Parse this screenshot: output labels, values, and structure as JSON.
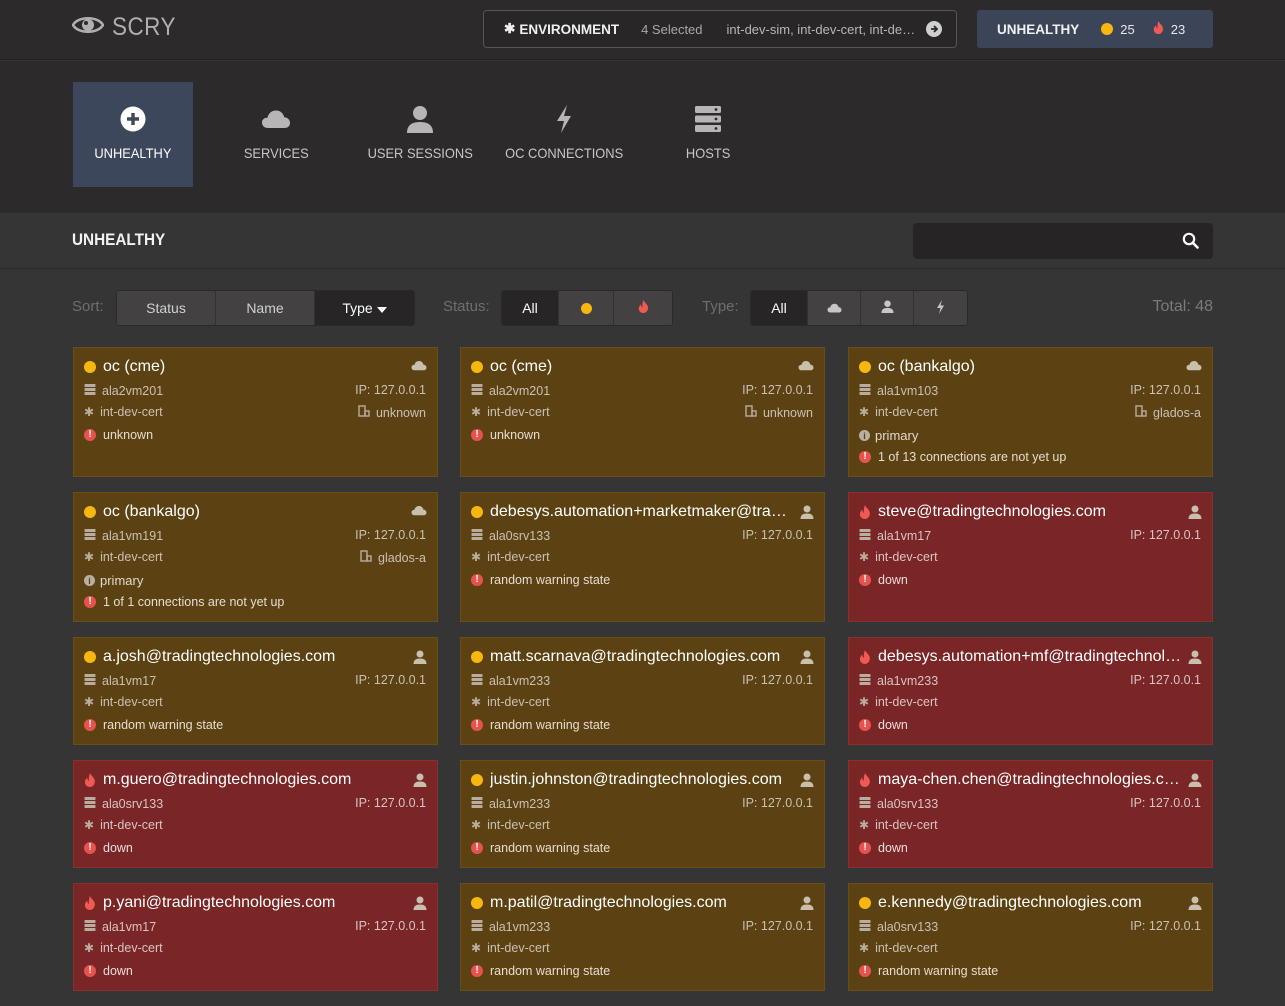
{
  "app": {
    "name": "SCRY"
  },
  "header": {
    "environment_label": "ENVIRONMENT",
    "environment_count": "4 Selected",
    "environment_list": "int-dev-sim, int-dev-cert, int-dev-prod, int-dev-test",
    "unhealthy_label": "UNHEALTHY",
    "warn_count": "25",
    "crit_count": "23"
  },
  "nav": {
    "items": [
      {
        "label": "UNHEALTHY",
        "icon": "plus-circle-icon"
      },
      {
        "label": "SERVICES",
        "icon": "cloud-icon"
      },
      {
        "label": "USER SESSIONS",
        "icon": "user-icon"
      },
      {
        "label": "OC CONNECTIONS",
        "icon": "bolt-icon"
      },
      {
        "label": "HOSTS",
        "icon": "server-icon"
      }
    ]
  },
  "section": {
    "title": "UNHEALTHY",
    "search_placeholder": ""
  },
  "filters": {
    "sort_label": "Sort:",
    "sort_options": [
      "Status",
      "Name",
      "Type"
    ],
    "status_label": "Status:",
    "status_all": "All",
    "type_label": "Type:",
    "type_all": "All",
    "total": "Total: 48"
  },
  "cards": [
    {
      "status": "warn",
      "type": "cloud",
      "name": "oc (cme)",
      "host": "ala2vm201",
      "ip": "IP: 127.0.0.1",
      "env": "int-dev-cert",
      "server": "unknown",
      "primary": "",
      "messages": [
        "unknown"
      ]
    },
    {
      "status": "warn",
      "type": "cloud",
      "name": "oc (cme)",
      "host": "ala2vm201",
      "ip": "IP: 127.0.0.1",
      "env": "int-dev-cert",
      "server": "unknown",
      "primary": "",
      "messages": [
        "unknown"
      ]
    },
    {
      "status": "warn",
      "type": "cloud",
      "name": "oc (bankalgo)",
      "host": "ala1vm103",
      "ip": "IP: 127.0.0.1",
      "env": "int-dev-cert",
      "server": "glados-a",
      "primary": "primary",
      "messages": [
        "1 of 13 connections are not yet up"
      ]
    },
    {
      "status": "warn",
      "type": "cloud",
      "name": "oc (bankalgo)",
      "host": "ala1vm191",
      "ip": "IP: 127.0.0.1",
      "env": "int-dev-cert",
      "server": "glados-a",
      "primary": "primary",
      "messages": [
        "1 of 1 connections are not yet up"
      ]
    },
    {
      "status": "warn",
      "type": "user",
      "name": "debesys.automation+marketmaker@tradingtechnologies.com",
      "host": "ala0srv133",
      "ip": "IP: 127.0.0.1",
      "env": "int-dev-cert",
      "server": "",
      "primary": "",
      "messages": [
        "random warning state"
      ]
    },
    {
      "status": "crit",
      "type": "user",
      "name": "steve@tradingtechnologies.com",
      "host": "ala1vm17",
      "ip": "IP: 127.0.0.1",
      "env": "int-dev-cert",
      "server": "",
      "primary": "",
      "messages": [
        "down"
      ]
    },
    {
      "status": "warn",
      "type": "user",
      "name": "a.josh@tradingtechnologies.com",
      "host": "ala1vm17",
      "ip": "IP: 127.0.0.1",
      "env": "int-dev-cert",
      "server": "",
      "primary": "",
      "messages": [
        "random warning state"
      ]
    },
    {
      "status": "warn",
      "type": "user",
      "name": "matt.scarnava@tradingtechnologies.com",
      "host": "ala1vm233",
      "ip": "IP: 127.0.0.1",
      "env": "int-dev-cert",
      "server": "",
      "primary": "",
      "messages": [
        "random warning state"
      ]
    },
    {
      "status": "crit",
      "type": "user",
      "name": "debesys.automation+mf@tradingtechnologies.com",
      "host": "ala1vm233",
      "ip": "IP: 127.0.0.1",
      "env": "int-dev-cert",
      "server": "",
      "primary": "",
      "messages": [
        "down"
      ]
    },
    {
      "status": "crit",
      "type": "user",
      "name": "m.guero@tradingtechnologies.com",
      "host": "ala0srv133",
      "ip": "IP: 127.0.0.1",
      "env": "int-dev-cert",
      "server": "",
      "primary": "",
      "messages": [
        "down"
      ]
    },
    {
      "status": "warn",
      "type": "user",
      "name": "justin.johnston@tradingtechnologies.com",
      "host": "ala1vm233",
      "ip": "IP: 127.0.0.1",
      "env": "int-dev-cert",
      "server": "",
      "primary": "",
      "messages": [
        "random warning state"
      ]
    },
    {
      "status": "crit",
      "type": "user",
      "name": "maya-chen.chen@tradingtechnologies.com",
      "host": "ala0srv133",
      "ip": "IP: 127.0.0.1",
      "env": "int-dev-cert",
      "server": "",
      "primary": "",
      "messages": [
        "down"
      ]
    },
    {
      "status": "crit",
      "type": "user",
      "name": "p.yani@tradingtechnologies.com",
      "host": "ala1vm17",
      "ip": "IP: 127.0.0.1",
      "env": "int-dev-cert",
      "server": "",
      "primary": "",
      "messages": [
        "down"
      ]
    },
    {
      "status": "warn",
      "type": "user",
      "name": "m.patil@tradingtechnologies.com",
      "host": "ala1vm233",
      "ip": "IP: 127.0.0.1",
      "env": "int-dev-cert",
      "server": "",
      "primary": "",
      "messages": [
        "random warning state"
      ]
    },
    {
      "status": "warn",
      "type": "user",
      "name": "e.kennedy@tradingtechnologies.com",
      "host": "ala0srv133",
      "ip": "IP: 127.0.0.1",
      "env": "int-dev-cert",
      "server": "",
      "primary": "",
      "messages": [
        "random warning state"
      ]
    }
  ],
  "colors": {
    "warn_dot": "#f7b70f",
    "crit_flame": "#f05a52",
    "warn_card": "#5c4212",
    "crit_card": "#7a2526",
    "active_nav": "#3d475c"
  }
}
